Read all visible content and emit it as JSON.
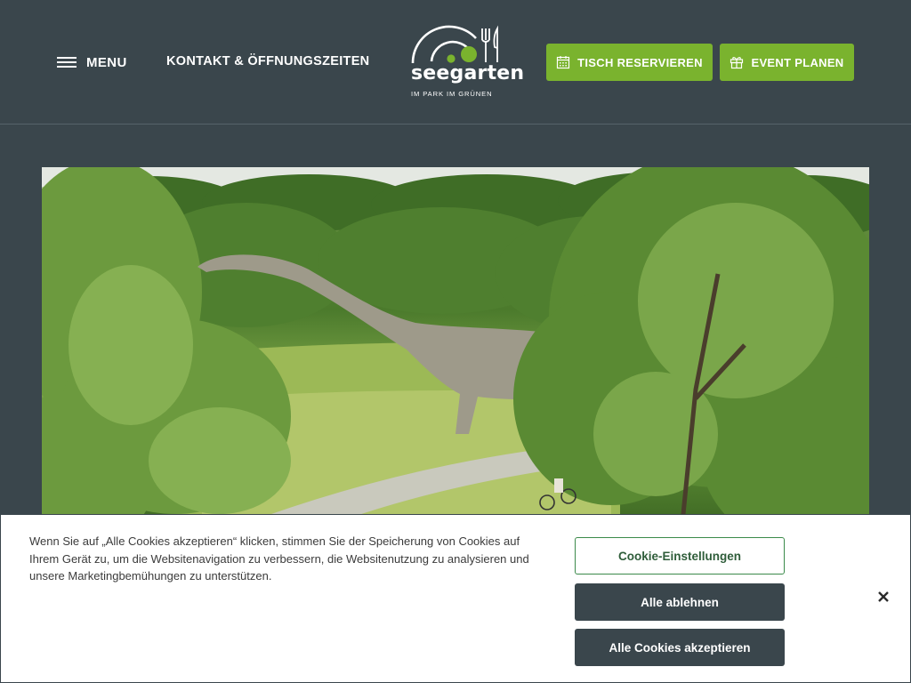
{
  "header": {
    "menu_label": "MENU",
    "contact_label": "KONTAKT & ÖFFNUNGSZEITEN",
    "logo": {
      "name": "seegarten",
      "tagline": "IM PARK IM GRÜNEN"
    },
    "reserve_label": "TISCH RESERVIEREN",
    "event_label": "EVENT PLANEN"
  },
  "hero": {
    "alt_icon": "dinosaur-park-photo"
  },
  "cookie_banner": {
    "text": "Wenn Sie auf „Alle Cookies akzeptieren“ klicken, stimmen Sie der Speicherung von Cookies auf Ihrem Gerät zu, um die Websitenavigation zu verbessern, die Websitenutzung zu analysieren und unsere Marketingbemühungen zu unterstützen.",
    "settings_label": "Cookie-Einstellungen",
    "reject_label": "Alle ablehnen",
    "accept_label": "Alle Cookies akzeptieren",
    "close_icon": "close-icon"
  },
  "colors": {
    "background": "#3a464c",
    "accent_green": "#7ab32e",
    "settings_border": "#3b8a4a"
  }
}
